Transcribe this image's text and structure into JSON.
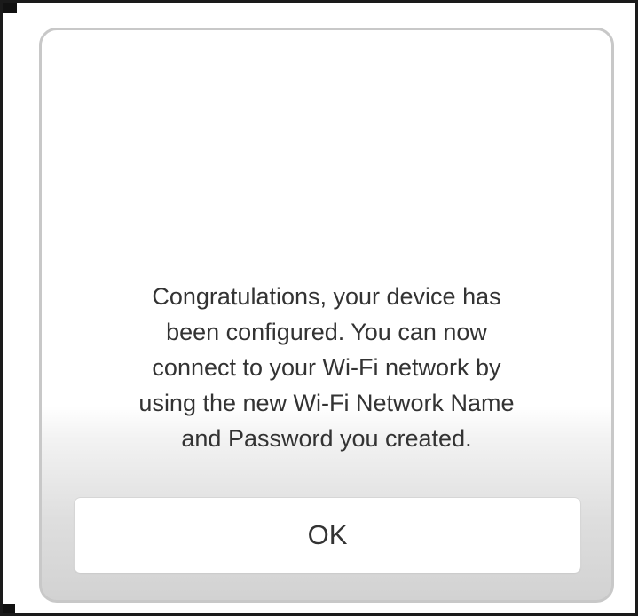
{
  "dialog": {
    "message": "Congratulations, your device has\nbeen configured. You can now\nconnect to your Wi-Fi network by\nusing the new Wi-Fi Network Name\nand Password you created.",
    "ok_label": "OK"
  },
  "colors": {
    "dialog_border": "#c8c8c8",
    "text": "#333333",
    "gradient_bottom": "#d2d2d2"
  }
}
